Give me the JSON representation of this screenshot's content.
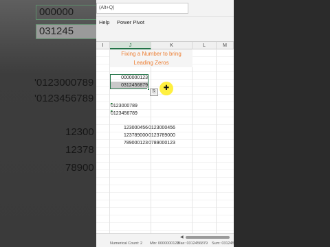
{
  "search": {
    "placeholder": "(Alt+Q)"
  },
  "menu": {
    "items": [
      "Help",
      "Power Pivot"
    ]
  },
  "columns": [
    "I",
    "J",
    "K",
    "L",
    "M"
  ],
  "title": {
    "line1": "Fixing a Number to bring",
    "line2": "Leading Zeros"
  },
  "selected_cells": {
    "top": "0000000123",
    "bottom": "0312456879"
  },
  "pasted_text": [
    "0123000789",
    "0123456789"
  ],
  "table": {
    "col_j": [
      "123000456",
      "123789000",
      "789000123"
    ],
    "col_k": [
      "0123000456",
      "0123789000",
      "0789000123"
    ]
  },
  "left_background": {
    "top": [
      "000000",
      "031245"
    ],
    "middle": [
      "'0123000789",
      "'0123456789"
    ],
    "bottom": [
      "12300",
      "12378",
      "78900"
    ]
  },
  "statusbar": {
    "items": [
      "Numerical Count: 2",
      "Min: 0000000123",
      "Max: 0312456879",
      "Sum: 0312456"
    ]
  },
  "colors": {
    "accent": "#217346",
    "title": "#ed7d31",
    "indicator": "#1f8f3a",
    "cursor": "#ffeb00"
  },
  "icons": {
    "paste": "paste-options-icon",
    "cursor": "move-cursor-icon"
  }
}
